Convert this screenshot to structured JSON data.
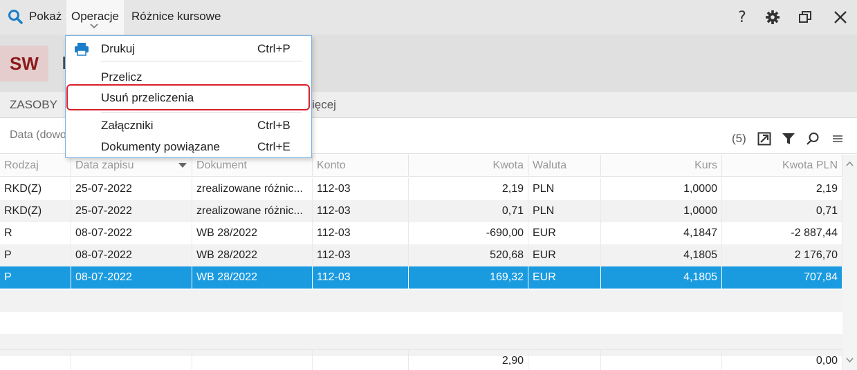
{
  "menubar": {
    "show_label": "Pokaż",
    "operations_label": "Operacje",
    "exchange_diff_label": "Różnice kursowe"
  },
  "header": {
    "badge": "SW",
    "title_partial": "I"
  },
  "tabs": {
    "zasoby": "ZASOBY",
    "more_partial": "ięcej"
  },
  "toolbar": {
    "filter_text": "Data (dowo",
    "count": "(5)"
  },
  "dropdown": {
    "items": [
      {
        "label": "Drukuj",
        "shortcut": "Ctrl+P"
      },
      {
        "label": "Przelicz",
        "shortcut": ""
      },
      {
        "label": "Usuń przeliczenia",
        "shortcut": ""
      },
      {
        "label": "Załączniki",
        "shortcut": "Ctrl+B"
      },
      {
        "label": "Dokumenty powiązane",
        "shortcut": "Ctrl+E"
      }
    ]
  },
  "table": {
    "columns": [
      "Rodzaj",
      "Data zapisu",
      "Dokument",
      "Konto",
      "Kwota",
      "Waluta",
      "Kurs",
      "Kwota PLN"
    ],
    "rows": [
      [
        "RKD(Z)",
        "25-07-2022",
        "zrealizowane różnic...",
        "112-03",
        "2,19",
        "PLN",
        "1,0000",
        "2,19"
      ],
      [
        "RKD(Z)",
        "25-07-2022",
        "zrealizowane różnic...",
        "112-03",
        "0,71",
        "PLN",
        "1,0000",
        "0,71"
      ],
      [
        "R",
        "08-07-2022",
        "WB 28/2022",
        "112-03",
        "-690,00",
        "EUR",
        "4,1847",
        "-2 887,44"
      ],
      [
        "P",
        "08-07-2022",
        "WB 28/2022",
        "112-03",
        "520,68",
        "EUR",
        "4,1805",
        "2 176,70"
      ],
      [
        "P",
        "08-07-2022",
        "WB 28/2022",
        "112-03",
        "169,32",
        "EUR",
        "4,1805",
        "707,84"
      ]
    ],
    "selected_row": 4,
    "totals": {
      "kwota": "2,90",
      "kwota_pln": "0,00"
    }
  },
  "colors": {
    "selection": "#1a9be0",
    "highlight_outline": "#d9202a",
    "badge_text": "#8b1a1a",
    "search_icon": "#1a7fc8"
  }
}
